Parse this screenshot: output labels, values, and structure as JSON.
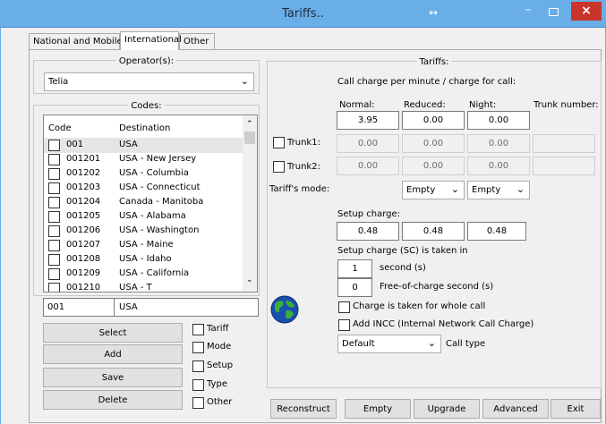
{
  "window": {
    "title": "Tariffs..",
    "controls": {
      "move_glyph": "↔",
      "minimize": "–",
      "close": "×"
    }
  },
  "tabs": [
    {
      "label": "National and Mobile"
    },
    {
      "label": "International"
    },
    {
      "label": "Other"
    }
  ],
  "left": {
    "operator_label": "Operator(s):",
    "operator_value": "Telia",
    "codes_label": "Codes:",
    "columns": [
      "Code",
      "Destination"
    ],
    "rows": [
      {
        "code": "001",
        "dest": "USA"
      },
      {
        "code": "001201",
        "dest": "USA - New Jersey"
      },
      {
        "code": "001202",
        "dest": "USA - Columbia"
      },
      {
        "code": "001203",
        "dest": "USA - Connecticut"
      },
      {
        "code": "001204",
        "dest": "Canada - Manitoba"
      },
      {
        "code": "001205",
        "dest": "USA - Alabama"
      },
      {
        "code": "001206",
        "dest": "USA - Washington"
      },
      {
        "code": "001207",
        "dest": "USA - Maine"
      },
      {
        "code": "001208",
        "dest": "USA - Idaho"
      },
      {
        "code": "001209",
        "dest": "USA - California"
      },
      {
        "code": "001210",
        "dest": "USA - T"
      }
    ],
    "edit_code": "001",
    "edit_dest": "USA",
    "buttons": {
      "select": "Select",
      "add": "Add",
      "save": "Save",
      "delete": "Delete"
    },
    "checks": {
      "tariff": "Tariff",
      "mode": "Mode",
      "setup": "Setup",
      "type": "Type",
      "other": "Other"
    }
  },
  "right": {
    "group_label": "Tariffs:",
    "desc": "Call charge per minute / charge for call:",
    "col_normal": "Normal:",
    "col_reduced": "Reduced:",
    "col_night": "Night:",
    "col_trunk": "Trunk number:",
    "main_values": {
      "normal": "3.95",
      "reduced": "0.00",
      "night": "0.00"
    },
    "trunk1": {
      "label": "Trunk1:",
      "normal": "0.00",
      "reduced": "0.00",
      "night": "0.00"
    },
    "trunk2": {
      "label": "Trunk2:",
      "normal": "0.00",
      "reduced": "0.00",
      "night": "0.00"
    },
    "mode_label": "Tariff's mode:",
    "mode1": "Empty",
    "mode2": "Empty",
    "setup_label": "Setup charge:",
    "setup_values": {
      "normal": "0.48",
      "reduced": "0.48",
      "night": "0.48"
    },
    "sc_label": "Setup charge (SC) is taken in",
    "sc_seconds": "1",
    "sc_seconds_label": "second (s)",
    "free_seconds": "0",
    "free_label": "Free-of-charge second (s)",
    "whole_call": "Charge is taken for whole call",
    "incc": "Add INCC (Internal Network Call Charge)",
    "calltype_value": "Default",
    "calltype_label": "Call type"
  },
  "bottom": {
    "reconstruct": "Reconstruct",
    "empty": "Empty",
    "upgrade": "Upgrade",
    "advanced": "Advanced",
    "exit": "Exit"
  },
  "colors": {
    "titlebar": "#6aaee8",
    "close": "#c7352b",
    "selected_row": "#e5e5e5"
  }
}
